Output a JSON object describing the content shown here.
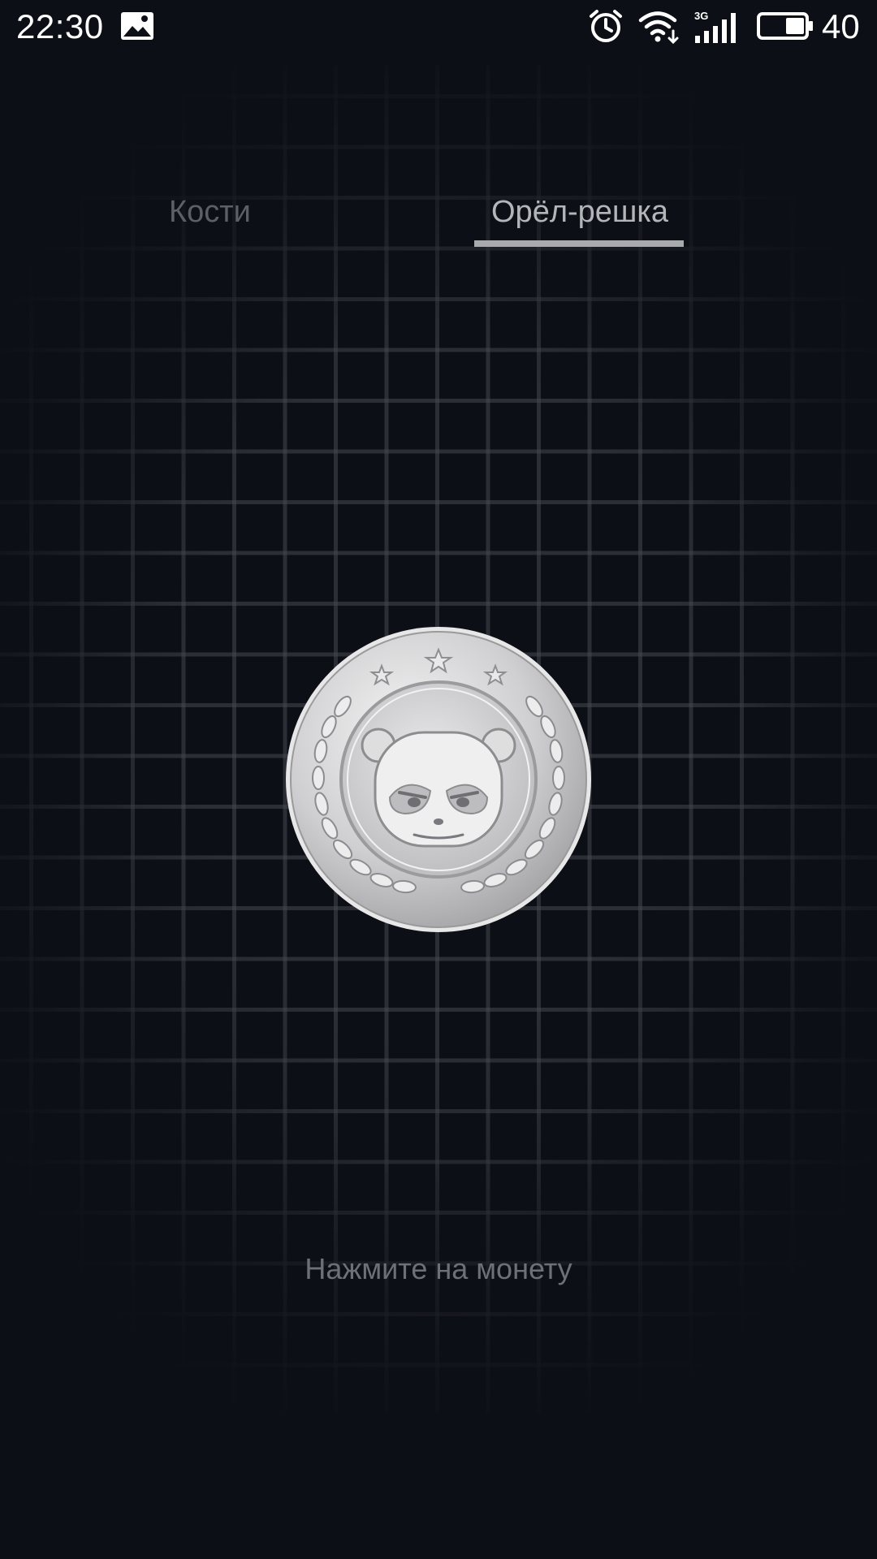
{
  "status_bar": {
    "time": "22:30",
    "battery_level": "40",
    "network_type": "3G",
    "icons": [
      "gallery-icon",
      "alarm-icon",
      "wifi-icon",
      "signal-icon",
      "battery-icon"
    ]
  },
  "tabs": [
    {
      "label": "Кости",
      "selected": false
    },
    {
      "label": "Орёл-решка",
      "selected": true
    }
  ],
  "coin": {
    "icon": "panda-coin-icon"
  },
  "hint": "Нажмите на монету",
  "colors": {
    "background": "#0d0f16",
    "tab_selected": "#b4b5b9",
    "tab_unselected": "#5d5f66",
    "indicator": "#a9aaae",
    "hint": "#6e7077"
  }
}
